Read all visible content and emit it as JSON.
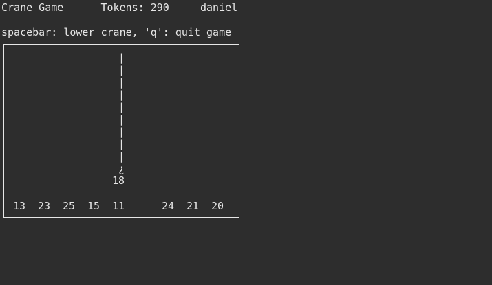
{
  "header": {
    "title": "Crane Game",
    "tokens_label": "Tokens:",
    "tokens_value": "290",
    "player": "daniel"
  },
  "help": {
    "text": "spacebar: lower crane, 'q': quit game"
  },
  "crane": {
    "rope_glyph": "|",
    "rope_segments": 9,
    "claw_glyph": "¿",
    "held_prize": "18"
  },
  "prizes": [
    "13",
    "23",
    "25",
    "15",
    "11",
    "",
    "24",
    "21",
    "20"
  ]
}
